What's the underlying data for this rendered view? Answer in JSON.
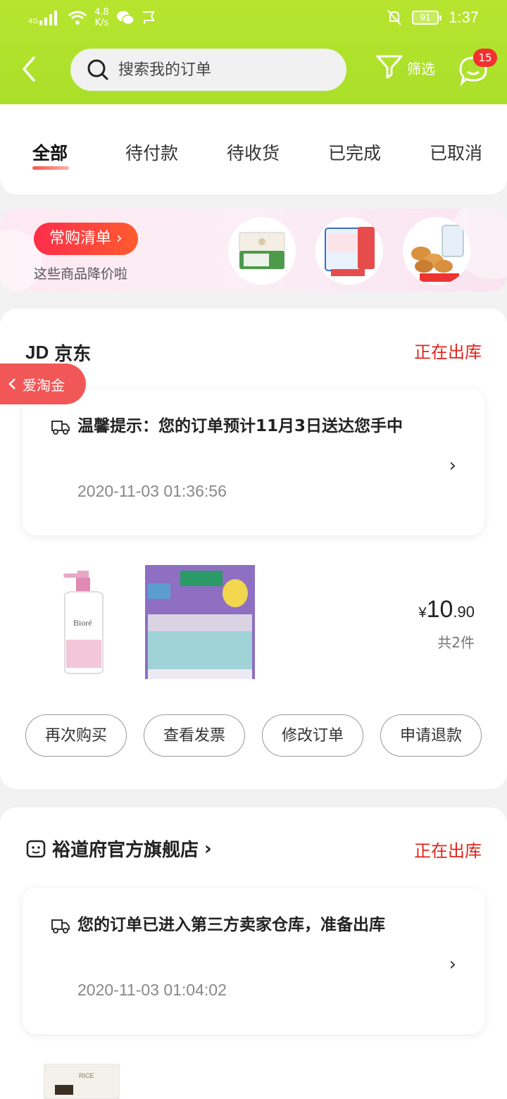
{
  "status_bar": {
    "network": "4G",
    "speed_value": "4.8",
    "speed_unit": "K/s",
    "battery": "91",
    "time": "1:37"
  },
  "header": {
    "search_placeholder": "搜索我的订单",
    "filter_label": "筛选",
    "message_badge": "15"
  },
  "tabs": [
    {
      "label": "全部",
      "active": true
    },
    {
      "label": "待付款",
      "active": false
    },
    {
      "label": "待收货",
      "active": false
    },
    {
      "label": "已完成",
      "active": false
    },
    {
      "label": "已取消",
      "active": false
    }
  ],
  "promo": {
    "button_label": "常购清单 ›",
    "subtitle": "这些商品降价啦"
  },
  "float_tag": {
    "label": "爱淘金"
  },
  "orders": [
    {
      "shop_logo": "JD",
      "shop_name": "京东",
      "status": "正在出库",
      "tip": "温馨提示：您的订单预计11月3日送达您手中",
      "tip_time": "2020-11-03 01:36:56",
      "price_symbol": "¥",
      "price_int": "10",
      "price_dec": ".90",
      "count": "共2件",
      "actions": [
        "再次购买",
        "查看发票",
        "修改订单",
        "申请退款"
      ]
    },
    {
      "shop_name": "裕道府官方旗舰店",
      "shop_arrow": "›",
      "status": "正在出库",
      "tip": "您的订单已进入第三方卖家仓库，准备出库",
      "tip_time": "2020-11-03 01:04:02"
    }
  ],
  "colors": {
    "header_green": "#b7e52f",
    "accent_red": "#e2231a",
    "badge_red": "#f23030"
  }
}
